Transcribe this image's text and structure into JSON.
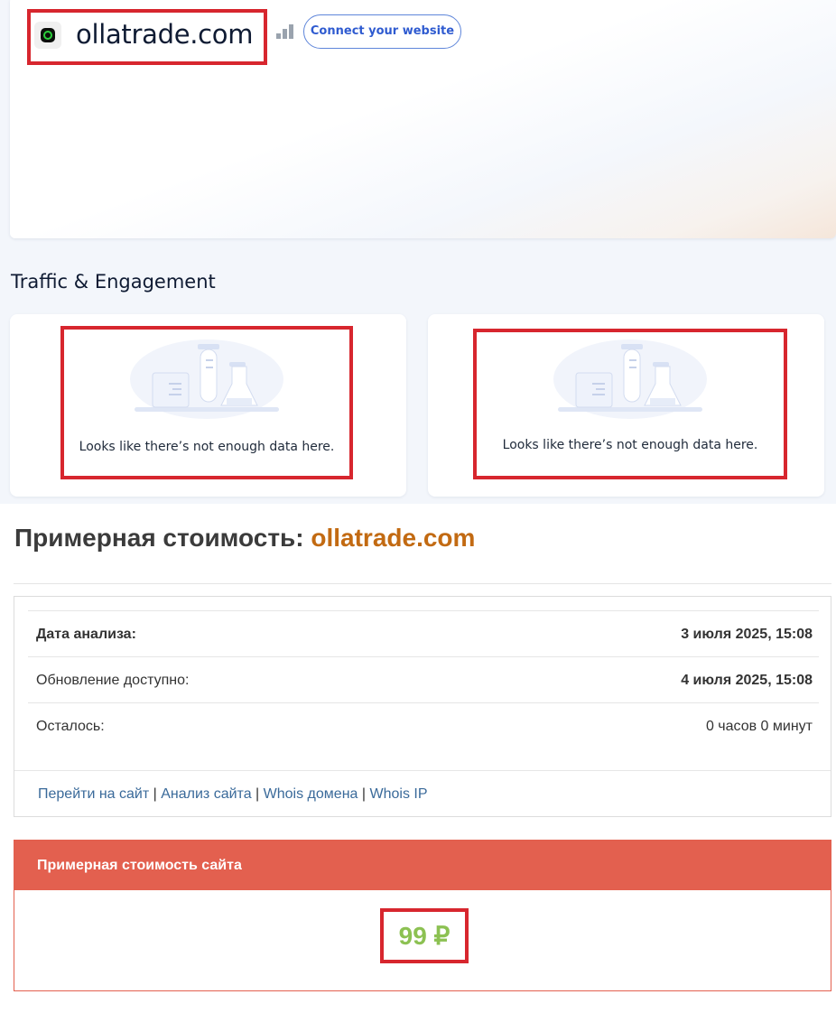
{
  "header": {
    "domain": "ollatrade.com",
    "connect_button": "Connect your website"
  },
  "traffic": {
    "title": "Traffic & Engagement",
    "cards": [
      {
        "message": "Looks like there’s not enough data here."
      },
      {
        "message": "Looks like there’s not enough data here."
      }
    ]
  },
  "valuation": {
    "title_prefix": "Примерная стоимость:",
    "title_domain": "ollatrade.com",
    "rows": [
      {
        "label": "Дата анализа:",
        "value": "3 июля 2025, 15:08"
      },
      {
        "label": "Обновление доступно:",
        "value": "4 июля 2025, 15:08"
      },
      {
        "label": "Осталось:",
        "value": "0 часов 0 минут"
      }
    ],
    "links": {
      "go_to_site": "Перейти на сайт",
      "site_analysis": "Анализ сайта",
      "whois_domain": "Whois домена",
      "whois_ip": "Whois IP",
      "separator": "|"
    },
    "price_header": "Примерная стоимость сайта",
    "price": "99 ₽"
  },
  "colors": {
    "highlight_border": "#d7262e",
    "accent_domain": "#c26a12",
    "price_header_bg": "#e3604f",
    "price_value": "#8cc152",
    "connect_button": "#2f5bd0"
  }
}
